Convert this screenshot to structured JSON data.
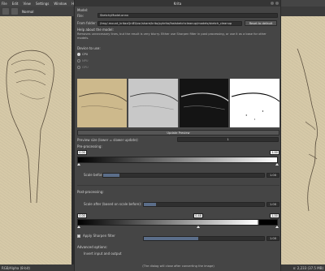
{
  "app": {
    "menu": [
      "File",
      "Edit",
      "View",
      "Settings",
      "Window",
      "Help"
    ],
    "layer_name": "Normal",
    "status_left": "RGB/Alpha (8-bit)",
    "status_right": "x: 2,233 (37.5 MB)"
  },
  "dialog": {
    "title": "Krita",
    "model_section": "Model:",
    "file_label": "File:",
    "file_value": "SketchyModel.onnx",
    "from_folder_label": "From folder:",
    "from_folder_value": "/tmp/.mount_kritaxQnIEl/usr/share/krita/pykrita/fastsketchcleanup/models/sketch_cleanup",
    "reset_button": "Reset to default",
    "help_about": "Help about the model:",
    "help_text": "Removes unnecessary lines, but the result is very blurry. Either use Sharpen filter in post processing, or use it as a base for other models.",
    "device_section": "Device to use:",
    "devices": [
      {
        "label": "CPU",
        "checked": true,
        "enabled": true
      },
      {
        "label": "NPU",
        "checked": false,
        "enabled": false
      },
      {
        "label": "GPU",
        "checked": false,
        "enabled": false
      }
    ],
    "update_preview_button": "Update Preview",
    "preview_size_label": "Preview size (lower = slower update):",
    "preview_size_value": "1",
    "preprocessing_section": "Pre-processing:",
    "pre_low": "0.00",
    "pre_high": "1.00",
    "scale_before_label": "Scale before:",
    "scale_before_value": "1.00",
    "scale_before_fraction": 0.1,
    "postprocessing_section": "Post-processing:",
    "scale_after_label": "Scale after (based on scale before):",
    "scale_after_value": "1.00",
    "scale_after_fraction": 0.1,
    "post_low": "0.00",
    "post_mid": "0.48",
    "post_high": "1.00",
    "sharpen_label": "Apply Sharpen filter",
    "sharpen_value": "1.00",
    "sharpen_fraction": 0.45,
    "advanced_section": "Advanced options:",
    "invert_label": "Invert input and output",
    "footer": "(The dialog will close after converting the image)"
  }
}
